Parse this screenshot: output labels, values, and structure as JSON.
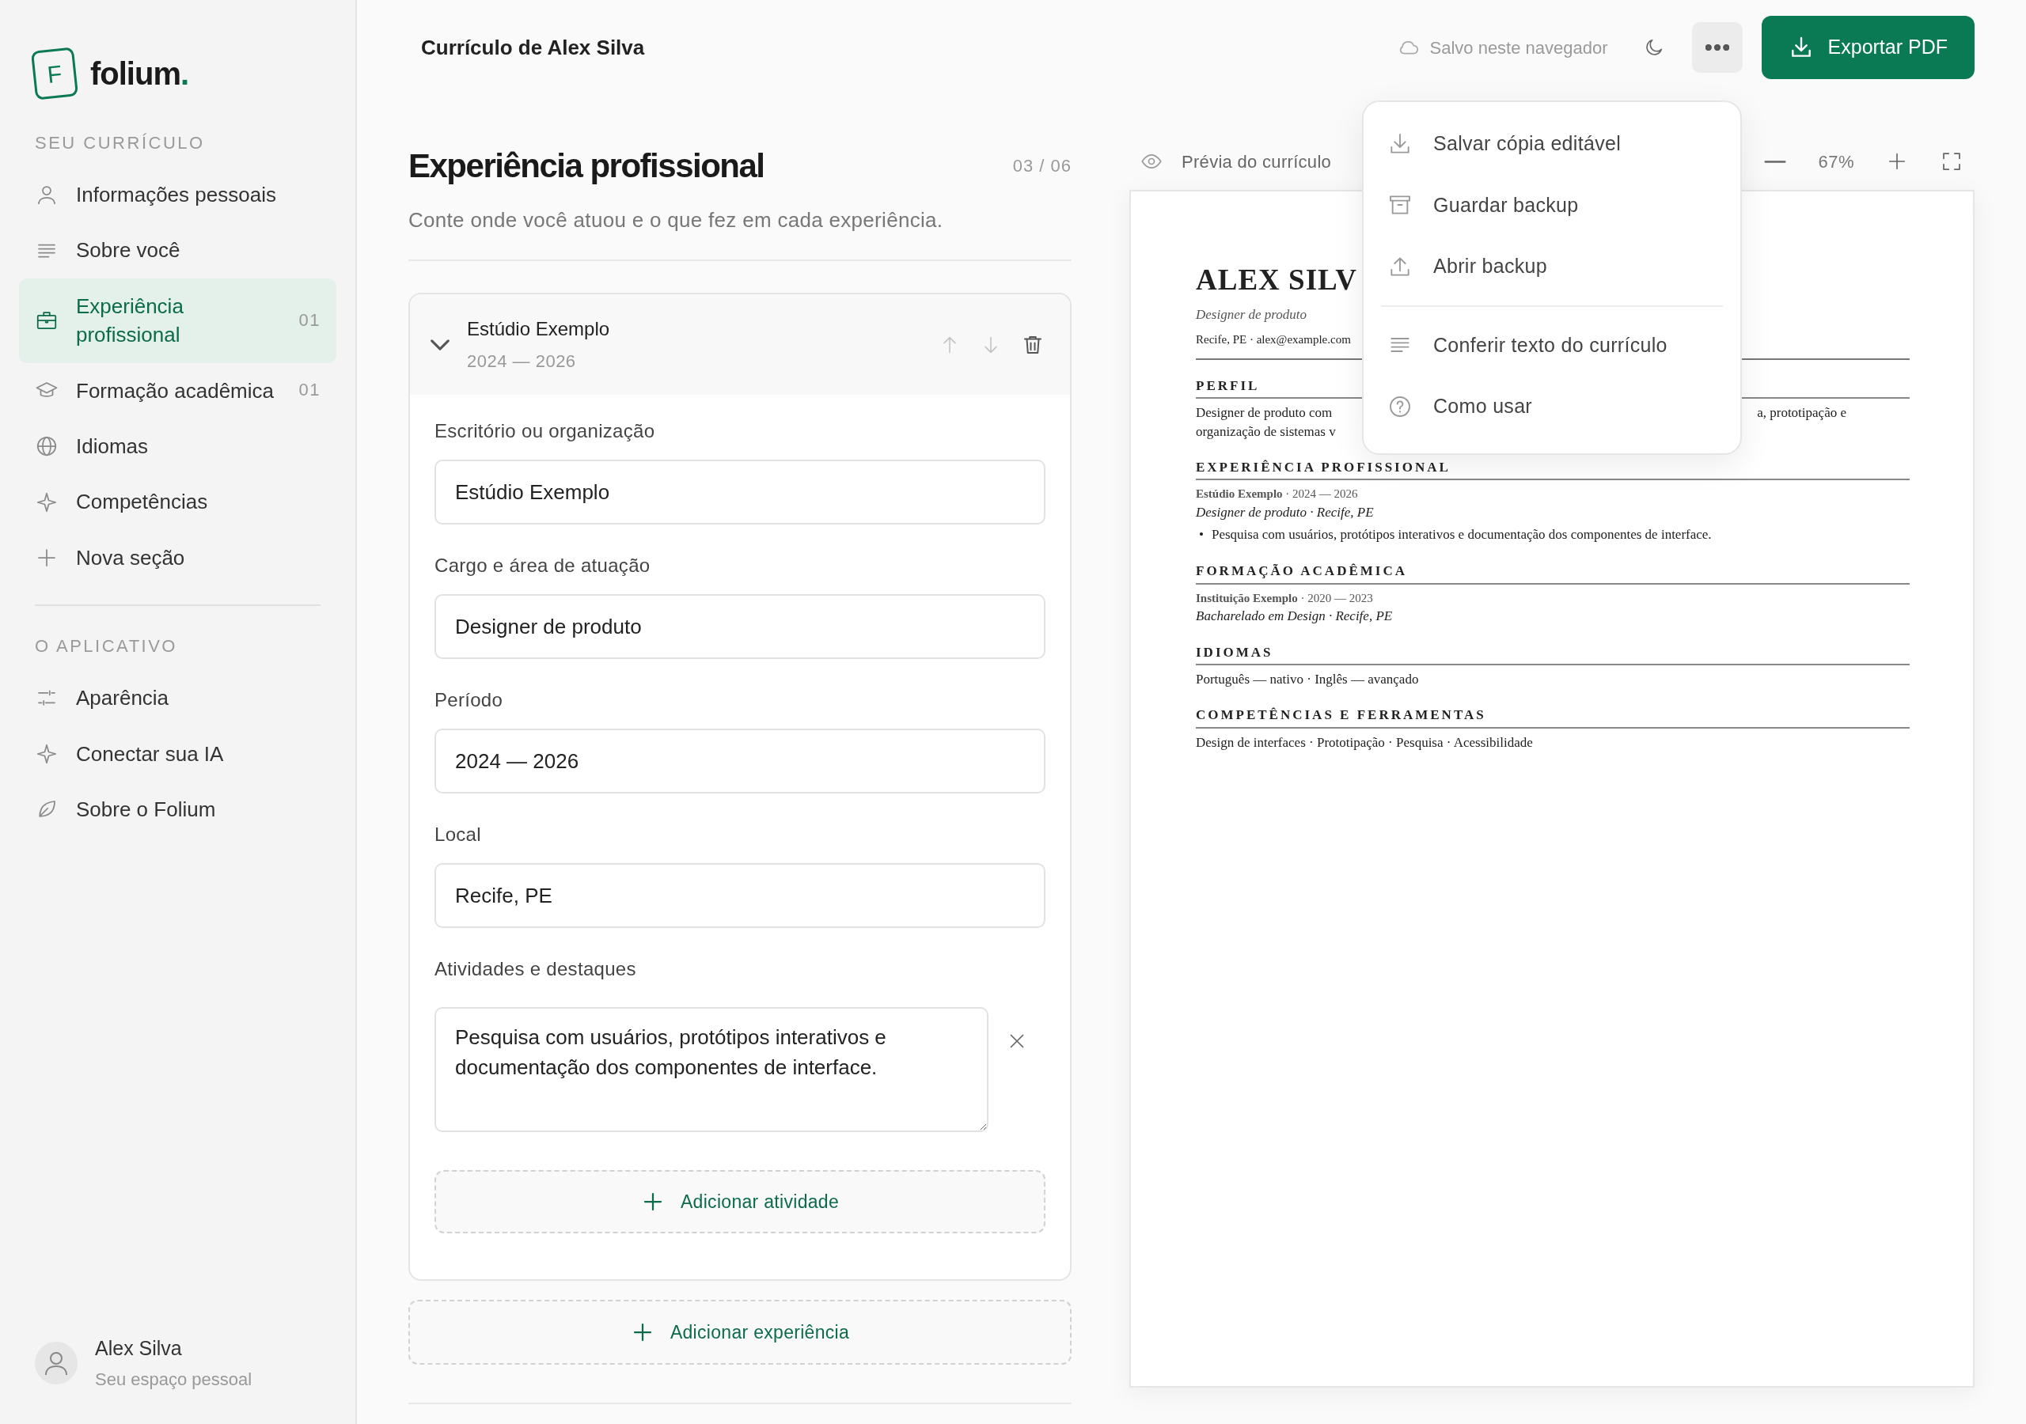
{
  "sidebar": {
    "logo_letter": "F",
    "brand": "folium",
    "brand_dot": ".",
    "sections": [
      {
        "heading": "SEU CURRÍCULO",
        "items": [
          {
            "label": "Informações pessoais",
            "selected": false
          },
          {
            "label": "Sobre você",
            "selected": false
          },
          {
            "label": "Experiência profissional",
            "count": "01",
            "selected": true
          },
          {
            "label": "Formação acadêmica",
            "count": "01",
            "selected": false
          },
          {
            "label": "Idiomas",
            "selected": false
          },
          {
            "label": "Competências",
            "selected": false
          },
          {
            "label": "Nova seção",
            "selected": false
          }
        ]
      },
      {
        "heading": "O APLICATIVO",
        "items": [
          {
            "label": "Aparência",
            "selected": false
          },
          {
            "label": "Conectar sua IA",
            "selected": false
          },
          {
            "label": "Sobre o Folium",
            "selected": false
          }
        ]
      }
    ],
    "user": {
      "name": "Alex Silva",
      "subtitle": "Seu espaço pessoal"
    }
  },
  "header": {
    "title": "Currículo de Alex Silva",
    "save_status": "Salvo neste navegador",
    "export_button": "Exportar PDF"
  },
  "menu": {
    "groups": [
      [
        "Salvar cópia editável",
        "Guardar backup",
        "Abrir backup"
      ],
      [
        "Conferir texto do currículo",
        "Como usar"
      ]
    ]
  },
  "editor": {
    "title": "Experiência profissional",
    "step": "03 / 06",
    "description": "Conte onde você atuou e o que fez em cada experiência.",
    "entries": [
      {
        "title": "Estúdio Exemplo",
        "period": "2024 — 2026",
        "expanded": true,
        "fields": [
          {
            "label": "Escritório ou organização",
            "value": "Estúdio Exemplo"
          },
          {
            "label": "Cargo e área de atuação",
            "value": "Designer de produto"
          },
          {
            "label": "Período",
            "value": "2024 — 2026"
          },
          {
            "label": "Local",
            "value": "Recife, PE"
          }
        ],
        "activities_label": "Atividades e destaques",
        "activities": [
          "Pesquisa com usuários, protótipos interativos e documentação dos componentes de interface."
        ],
        "add_activity": "Adicionar atividade"
      }
    ],
    "add_entry": "Adicionar experiência"
  },
  "preview": {
    "label": "Prévia do currículo",
    "zoom": "67%",
    "resume": {
      "name": "ALEX SILV",
      "role": "Designer de produto",
      "contact": "Recife, PE · alex@example.com",
      "sections": [
        {
          "heading": "PERFIL",
          "kind": "cut_paragraph",
          "left": "Designer de produto com",
          "right": "a, prototipação e",
          "line2": "organização de sistemas v"
        },
        {
          "heading": "EXPERIÊNCIA PROFISSIONAL",
          "kind": "entries",
          "entries": [
            {
              "line": "**Estúdio Exemplo** · 2024 — 2026",
              "detail": "Designer de produto · Recife, PE",
              "bullet": "•",
              "bullets": [
                "Pesquisa com usuários, protótipos interativos e documentação dos componentes de interface."
              ]
            }
          ]
        },
        {
          "heading": "FORMAÇÃO ACADÊMICA",
          "kind": "entries",
          "entries": [
            {
              "line": "**Instituição Exemplo** · 2020 — 2023",
              "detail": "Bacharelado em Design · Recife, PE"
            }
          ]
        },
        {
          "heading": "IDIOMAS",
          "kind": "text",
          "text": "Português — nativo · Inglês — avançado"
        },
        {
          "heading": "COMPETÊNCIAS E FERRAMENTAS",
          "kind": "text",
          "text": "Design de interfaces · Prototipação · Pesquisa · Acessibilidade"
        }
      ]
    }
  }
}
